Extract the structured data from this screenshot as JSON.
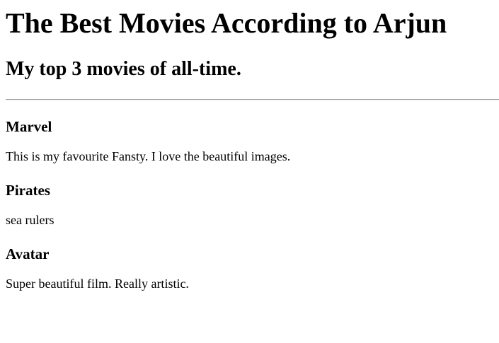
{
  "header": {
    "title": "The Best Movies According to Arjun",
    "subtitle": "My top 3 movies of all-time."
  },
  "movies": [
    {
      "title": "Marvel",
      "description": "This is my favourite Fansty. I love the beautiful images."
    },
    {
      "title": "Pirates",
      "description": "sea rulers"
    },
    {
      "title": "Avatar",
      "description": "Super beautiful film. Really artistic."
    }
  ]
}
